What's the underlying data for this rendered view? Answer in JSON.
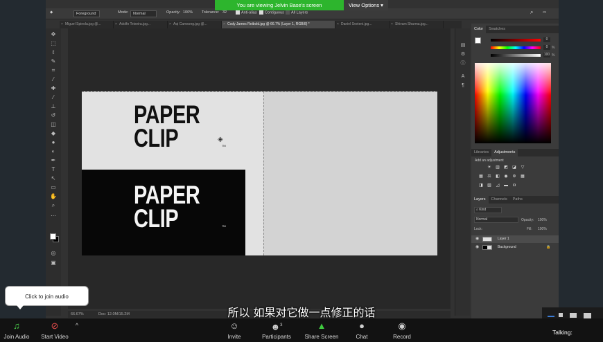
{
  "zoom": {
    "banner": "You are viewing Jelvin Base's screen",
    "view_options": "View Options",
    "tooltip": "Click to join audio",
    "subtitle": "所以 如果对它做一点修正的话",
    "talking": "Talking:",
    "buttons": [
      {
        "label": "Join Audio",
        "icon": "headphones-icon"
      },
      {
        "label": "Start Video",
        "icon": "video-off-icon"
      },
      {
        "label": "Invite",
        "icon": "invite-icon"
      },
      {
        "label": "Participants",
        "icon": "participants-icon",
        "count": "3"
      },
      {
        "label": "Share Screen",
        "icon": "share-screen-icon"
      },
      {
        "label": "Chat",
        "icon": "chat-icon"
      },
      {
        "label": "Record",
        "icon": "record-icon"
      }
    ],
    "accent": "#2db52d"
  },
  "options_bar": {
    "tool_preset": "Foreground",
    "mode_label": "Mode:",
    "mode_value": "Normal",
    "opacity_label": "Opacity:",
    "opacity_value": "100%",
    "tolerance_label": "Tolerance:",
    "tolerance_value": "32",
    "anti_alias": "Anti-alias",
    "contiguous": "Contiguous",
    "all_layers": "All Layers"
  },
  "doc_tabs": [
    {
      "label": "Miguel Spinola.jpg @...",
      "active": false
    },
    {
      "label": "Adolfo Teixeira.jpg...",
      "active": false
    },
    {
      "label": "Aqi Camsong.jpg @...",
      "active": false
    },
    {
      "label": "Cody James Reibold.jpg @ 66.7% (Layer 1, RGB/8) *",
      "active": true
    },
    {
      "label": "Daniel Sveteni.jpg...",
      "active": false
    },
    {
      "label": "Shivam Sharma.jpg...",
      "active": false
    }
  ],
  "canvas": {
    "logo_line1": "PAPER",
    "logo_line2": "CLIP",
    "tm": "TM"
  },
  "status_bar": {
    "zoom": "66.67%",
    "doc": "Doc: 12.0M/15.2M"
  },
  "panels": {
    "color_tabs": [
      "Color",
      "Swatches"
    ],
    "color_values": [
      "0",
      "0",
      "100"
    ],
    "adjust_tabs": [
      "Libraries",
      "Adjustments"
    ],
    "adjust_label": "Add an adjustment",
    "layers_tabs": [
      "Layers",
      "Channels",
      "Paths"
    ],
    "kind": "Kind",
    "blend_mode": "Normal",
    "opacity_label": "Opacity:",
    "opacity_value": "100%",
    "lock_label": "Lock:",
    "fill_label": "Fill:",
    "fill_value": "100%",
    "layers": [
      {
        "name": "Layer 1",
        "selected": true
      },
      {
        "name": "Background",
        "selected": false
      }
    ]
  }
}
